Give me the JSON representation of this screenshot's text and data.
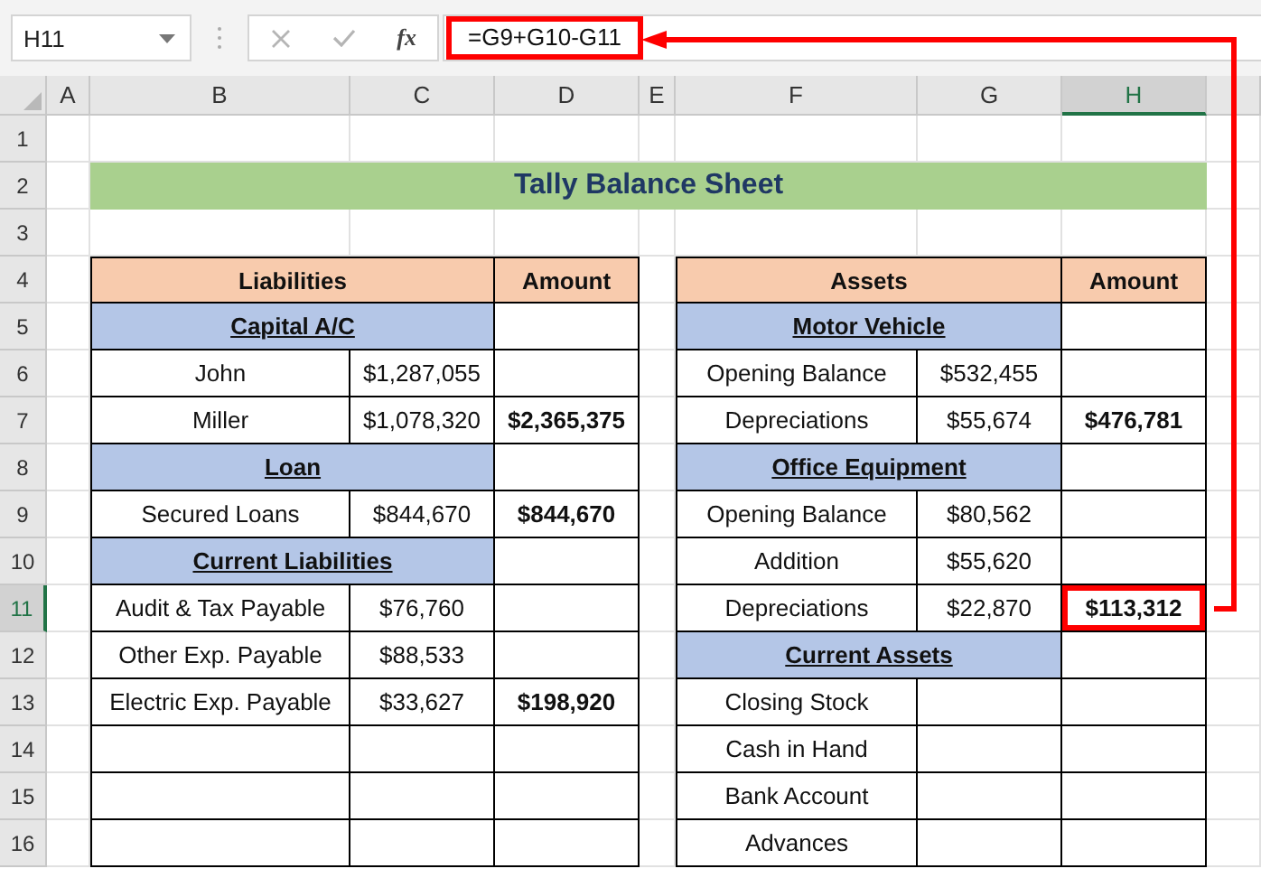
{
  "formula_bar": {
    "name_box": "H11",
    "function_label": "fx",
    "formula": "=G9+G10-G11"
  },
  "sheet": {
    "columns": [
      {
        "label": "A",
        "selected": false
      },
      {
        "label": "B",
        "selected": false
      },
      {
        "label": "C",
        "selected": false
      },
      {
        "label": "D",
        "selected": false
      },
      {
        "label": "E",
        "selected": false
      },
      {
        "label": "F",
        "selected": false
      },
      {
        "label": "G",
        "selected": false
      },
      {
        "label": "H",
        "selected": true
      }
    ],
    "rows": [
      {
        "number": "1",
        "selected": false
      },
      {
        "number": "2",
        "selected": false,
        "title": "Tally Balance Sheet"
      },
      {
        "number": "3",
        "selected": false
      },
      {
        "number": "4",
        "selected": false,
        "left": [
          {
            "kind": "head",
            "text": "Liabilities"
          },
          {
            "kind": "amount_head",
            "text": "Amount"
          }
        ],
        "right": [
          {
            "kind": "head",
            "text": "Assets"
          },
          {
            "kind": "amount_head",
            "text": "Amount"
          }
        ]
      },
      {
        "number": "5",
        "selected": false,
        "left": [
          {
            "kind": "section",
            "text": "Capital A/C"
          },
          {
            "kind": "empty"
          }
        ],
        "right": [
          {
            "kind": "section",
            "text": "Motor Vehicle"
          },
          {
            "kind": "empty"
          }
        ]
      },
      {
        "number": "6",
        "selected": false,
        "left": [
          {
            "kind": "text",
            "text": "John"
          },
          {
            "kind": "value",
            "text": "$1,287,055"
          },
          {
            "kind": "empty"
          }
        ],
        "right": [
          {
            "kind": "text",
            "text": "Opening Balance"
          },
          {
            "kind": "value",
            "text": "$532,455"
          },
          {
            "kind": "empty"
          }
        ]
      },
      {
        "number": "7",
        "selected": false,
        "left": [
          {
            "kind": "text",
            "text": "Miller"
          },
          {
            "kind": "value",
            "text": "$1,078,320"
          },
          {
            "kind": "total",
            "text": "$2,365,375"
          }
        ],
        "right": [
          {
            "kind": "text",
            "text": "Depreciations"
          },
          {
            "kind": "value",
            "text": "$55,674"
          },
          {
            "kind": "total",
            "text": "$476,781"
          }
        ]
      },
      {
        "number": "8",
        "selected": false,
        "left": [
          {
            "kind": "section",
            "text": "Loan"
          },
          {
            "kind": "empty"
          }
        ],
        "right": [
          {
            "kind": "section",
            "text": "Office Equipment"
          },
          {
            "kind": "empty"
          }
        ]
      },
      {
        "number": "9",
        "selected": false,
        "left": [
          {
            "kind": "text",
            "text": "Secured Loans"
          },
          {
            "kind": "value",
            "text": "$844,670"
          },
          {
            "kind": "total",
            "text": "$844,670"
          }
        ],
        "right": [
          {
            "kind": "text",
            "text": "Opening Balance"
          },
          {
            "kind": "value",
            "text": "$80,562"
          },
          {
            "kind": "empty"
          }
        ]
      },
      {
        "number": "10",
        "selected": false,
        "left": [
          {
            "kind": "section",
            "text": "Current Liabilities"
          },
          {
            "kind": "empty"
          }
        ],
        "right": [
          {
            "kind": "text",
            "text": "Addition"
          },
          {
            "kind": "value",
            "text": "$55,620"
          },
          {
            "kind": "empty"
          }
        ]
      },
      {
        "number": "11",
        "selected": true,
        "left": [
          {
            "kind": "text",
            "text": "Audit & Tax Payable"
          },
          {
            "kind": "value",
            "text": "$76,760"
          },
          {
            "kind": "empty"
          }
        ],
        "right": [
          {
            "kind": "text",
            "text": "Depreciations"
          },
          {
            "kind": "value",
            "text": "$22,870"
          },
          {
            "kind": "total",
            "text": "$113,312"
          }
        ]
      },
      {
        "number": "12",
        "selected": false,
        "left": [
          {
            "kind": "text",
            "text": "Other Exp. Payable"
          },
          {
            "kind": "value",
            "text": "$88,533"
          },
          {
            "kind": "empty"
          }
        ],
        "right": [
          {
            "kind": "section",
            "text": "Current Assets"
          },
          {
            "kind": "empty"
          }
        ]
      },
      {
        "number": "13",
        "selected": false,
        "left": [
          {
            "kind": "text",
            "text": "Electric Exp. Payable"
          },
          {
            "kind": "value",
            "text": "$33,627"
          },
          {
            "kind": "total",
            "text": "$198,920"
          }
        ],
        "right": [
          {
            "kind": "text",
            "text": "Closing Stock"
          },
          {
            "kind": "empty"
          },
          {
            "kind": "empty"
          }
        ]
      },
      {
        "number": "14",
        "selected": false,
        "left": [
          {
            "kind": "empty"
          },
          {
            "kind": "empty"
          },
          {
            "kind": "empty"
          }
        ],
        "right": [
          {
            "kind": "text",
            "text": "Cash in Hand"
          },
          {
            "kind": "empty"
          },
          {
            "kind": "empty"
          }
        ]
      },
      {
        "number": "15",
        "selected": false,
        "left": [
          {
            "kind": "empty"
          },
          {
            "kind": "empty"
          },
          {
            "kind": "empty"
          }
        ],
        "right": [
          {
            "kind": "text",
            "text": "Bank Account"
          },
          {
            "kind": "empty"
          },
          {
            "kind": "empty"
          }
        ]
      },
      {
        "number": "16",
        "selected": false,
        "left": [
          {
            "kind": "empty"
          },
          {
            "kind": "empty"
          },
          {
            "kind": "empty"
          }
        ],
        "right": [
          {
            "kind": "text",
            "text": "Advances"
          },
          {
            "kind": "empty"
          },
          {
            "kind": "empty"
          }
        ]
      }
    ]
  }
}
